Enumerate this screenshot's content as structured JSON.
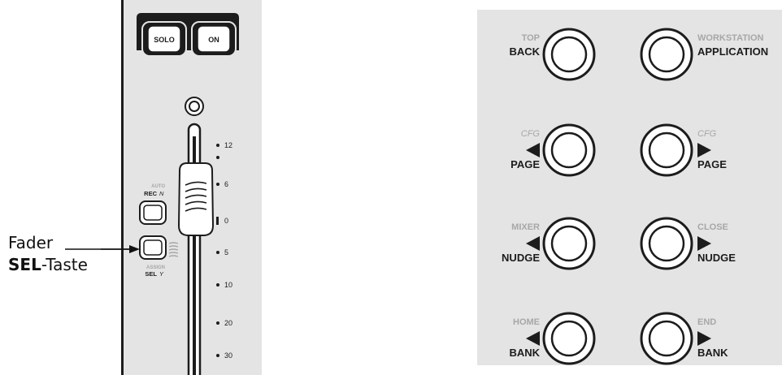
{
  "callout": {
    "line1": "Fader",
    "line2_bold": "SEL",
    "line2_rest": "-Taste"
  },
  "channel_strip": {
    "solo_label": "SOLO",
    "on_label": "ON",
    "rec_top": "AUTO",
    "rec_label": "REC",
    "rec_key": "N",
    "sel_top": "ASSIGN",
    "sel_label": "SEL",
    "sel_key": "Y",
    "scale": [
      {
        "label": "12"
      },
      {
        "label": ""
      },
      {
        "label": "6"
      },
      {
        "label": "0"
      },
      {
        "label": "5"
      },
      {
        "label": "10"
      },
      {
        "label": "20"
      },
      {
        "label": "30"
      }
    ]
  },
  "nav_panel": {
    "buttons": [
      {
        "top": "TOP",
        "bottom": "BACK",
        "arrow": "none",
        "top_italic": false
      },
      {
        "top": "WORKSTATION",
        "bottom": "APPLICATION",
        "arrow": "none",
        "top_italic": false
      },
      {
        "top": "CFG",
        "bottom": "PAGE",
        "arrow": "left",
        "top_italic": true
      },
      {
        "top": "CFG",
        "bottom": "PAGE",
        "arrow": "right",
        "top_italic": true
      },
      {
        "top": "MIXER",
        "bottom": "NUDGE",
        "arrow": "left",
        "top_italic": false
      },
      {
        "top": "CLOSE",
        "bottom": "NUDGE",
        "arrow": "right",
        "top_italic": false
      },
      {
        "top": "HOME",
        "bottom": "BANK",
        "arrow": "left",
        "top_italic": false
      },
      {
        "top": "END",
        "bottom": "BANK",
        "arrow": "right",
        "top_italic": false
      }
    ]
  },
  "colors": {
    "panel": "#e4e4e4",
    "ink": "#1c1c1c",
    "muted_label": "#a7a7a7"
  }
}
